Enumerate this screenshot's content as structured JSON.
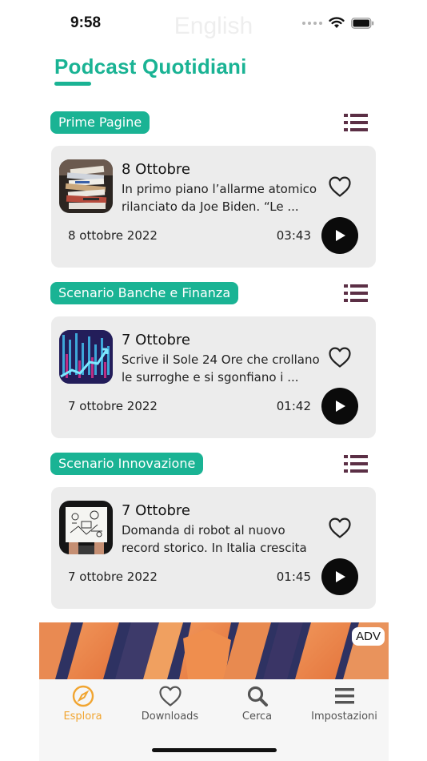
{
  "status": {
    "time": "9:58",
    "language": "English"
  },
  "page": {
    "title": "Podcast Quotidiani"
  },
  "sections": [
    {
      "label": "Prime Pagine",
      "episode": {
        "title": "8 Ottobre",
        "description": "In primo piano l’allarme atomico rilanciato da Joe Biden. “Le ...",
        "date": "8 ottobre 2022",
        "duration": "03:43"
      }
    },
    {
      "label": "Scenario Banche e Finanza",
      "episode": {
        "title": "7 Ottobre",
        "description": "Scrive il Sole 24 Ore che crollano le surroghe e si sgonfiano i ...",
        "date": "7 ottobre 2022",
        "duration": "01:42"
      }
    },
    {
      "label": "Scenario Innovazione",
      "episode": {
        "title": "7 Ottobre",
        "description": "Domanda di robot al nuovo record storico. In Italia crescita ...",
        "date": "7 ottobre 2022",
        "duration": "01:45"
      }
    }
  ],
  "ad": {
    "badge": "ADV"
  },
  "tabs": [
    {
      "label": "Esplora",
      "icon": "compass-icon",
      "active": true
    },
    {
      "label": "Downloads",
      "icon": "heart-icon",
      "active": false
    },
    {
      "label": "Cerca",
      "icon": "search-icon",
      "active": false
    },
    {
      "label": "Impostazioni",
      "icon": "menu-icon",
      "active": false
    }
  ],
  "colors": {
    "accent": "#1ab394",
    "active_tab": "#f1a531",
    "icon_dark": "#5b2f45",
    "card_bg": "#ececec"
  }
}
